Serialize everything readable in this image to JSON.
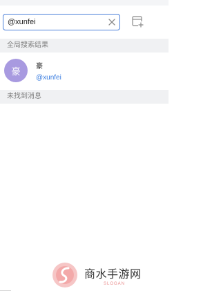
{
  "search": {
    "value": "@xunfei",
    "placeholder": ""
  },
  "sections": {
    "global_results": "全局搜索结果",
    "no_messages": "未找到消息"
  },
  "results": [
    {
      "avatar_text": "豪",
      "name": "豪",
      "handle": "@xunfei"
    }
  ],
  "icons": {
    "clear": "close-icon",
    "new_chat": "new-chat-icon"
  },
  "watermark": {
    "title": "商水手游网",
    "slogan": "SLOGAN"
  },
  "colors": {
    "accent": "#4a7fd9",
    "avatar": "#a89ae0",
    "handle": "#3a7de0"
  }
}
